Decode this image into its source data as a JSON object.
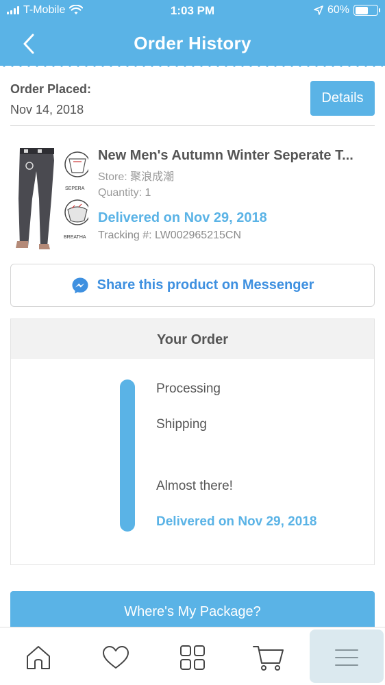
{
  "status_bar": {
    "carrier": "T-Mobile",
    "time": "1:03 PM",
    "battery": "60%",
    "battery_level": 0.6
  },
  "nav": {
    "title": "Order History"
  },
  "order_placed": {
    "label": "Order Placed:",
    "date": "Nov 14, 2018",
    "details_label": "Details"
  },
  "product": {
    "title": "New Men's Autumn Winter Seperate T...",
    "store": "Store: 聚浪成潮",
    "quantity": "Quantity: 1",
    "delivered": "Delivered on Nov 29, 2018",
    "tracking": "Tracking #: LW002965215CN",
    "thumb_captions": [
      "SEPERA",
      "BREATHA"
    ]
  },
  "share": {
    "label": "Share this product on Messenger"
  },
  "your_order": {
    "title": "Your Order",
    "steps": [
      "Processing",
      "Shipping",
      "Almost there!",
      "Delivered on Nov 29, 2018"
    ]
  },
  "package_button": {
    "label": "Where's My Package?"
  },
  "tab_bar": {
    "items": [
      "home-icon",
      "heart-icon",
      "grid-icon",
      "cart-icon",
      "menu-icon"
    ]
  },
  "colors": {
    "accent": "#5ab3e6",
    "messenger": "#3e90e0",
    "text": "#555555",
    "muted": "#9a9a9a"
  }
}
